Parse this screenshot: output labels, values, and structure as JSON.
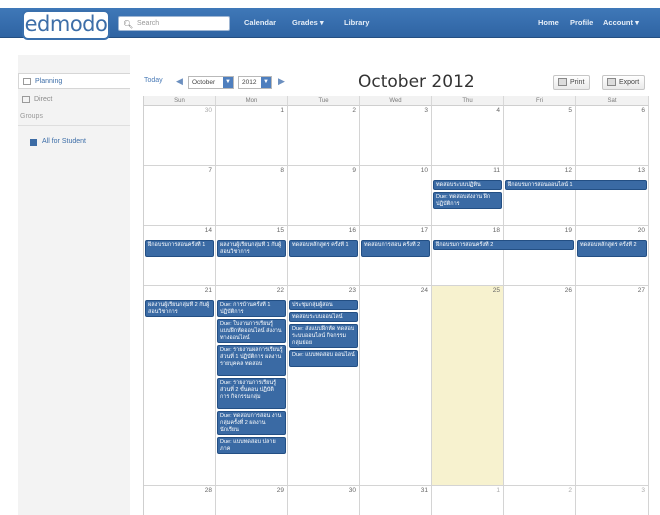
{
  "header": {
    "logo": "edmodo",
    "search_placeholder": "Search",
    "nav_left": [
      "Calendar",
      "Grades ▾",
      "Library"
    ],
    "nav_right": [
      "Home",
      "Profile",
      "Account ▾"
    ]
  },
  "sidebar": {
    "items": [
      {
        "label": "Planning",
        "active": true
      },
      {
        "label": "Direct",
        "active": false
      }
    ],
    "groups_label": "Groups",
    "groups": [
      {
        "label": "All for Student",
        "color": "#3c6ba4"
      }
    ]
  },
  "toolbar": {
    "today": "Today",
    "month_select": "October",
    "year_select": "2012",
    "title": "October 2012",
    "print": "Print",
    "export": "Export"
  },
  "calendar": {
    "weekdays": [
      "Sun",
      "Mon",
      "Tue",
      "Wed",
      "Thu",
      "Fri",
      "Sat"
    ],
    "today_cell": {
      "week": 3,
      "day": 4
    },
    "weeks": [
      {
        "days": [
          {
            "num": "30",
            "other": true
          },
          {
            "num": "1",
            "other": false
          },
          {
            "num": "2",
            "other": false
          },
          {
            "num": "3",
            "other": false
          },
          {
            "num": "4",
            "other": false
          },
          {
            "num": "5",
            "other": false
          },
          {
            "num": "6",
            "other": false
          }
        ]
      },
      {
        "days": [
          {
            "num": "7",
            "other": false
          },
          {
            "num": "8",
            "other": false
          },
          {
            "num": "9",
            "other": false
          },
          {
            "num": "10",
            "other": false
          },
          {
            "num": "11",
            "other": false
          },
          {
            "num": "12",
            "other": false
          },
          {
            "num": "13",
            "other": false
          }
        ]
      },
      {
        "days": [
          {
            "num": "14",
            "other": false
          },
          {
            "num": "15",
            "other": false
          },
          {
            "num": "16",
            "other": false
          },
          {
            "num": "17",
            "other": false
          },
          {
            "num": "18",
            "other": false
          },
          {
            "num": "19",
            "other": false
          },
          {
            "num": "20",
            "other": false
          }
        ]
      },
      {
        "days": [
          {
            "num": "21",
            "other": false
          },
          {
            "num": "22",
            "other": false
          },
          {
            "num": "23",
            "other": false
          },
          {
            "num": "24",
            "other": false
          },
          {
            "num": "25",
            "other": false
          },
          {
            "num": "26",
            "other": false
          },
          {
            "num": "27",
            "other": false
          }
        ]
      },
      {
        "days": [
          {
            "num": "28",
            "other": false
          },
          {
            "num": "29",
            "other": false
          },
          {
            "num": "30",
            "other": false
          },
          {
            "num": "31",
            "other": false
          },
          {
            "num": "1",
            "other": true
          },
          {
            "num": "2",
            "other": true
          },
          {
            "num": "3",
            "other": true
          }
        ]
      }
    ],
    "events": [
      {
        "week": 1,
        "day": 4,
        "span": 1,
        "slot": 0,
        "lines": 1,
        "text": "ทดสอบระบบปฏิทิน"
      },
      {
        "week": 1,
        "day": 4,
        "span": 1,
        "slot": 1,
        "lines": 2,
        "text": "Due: ทดสอบส่งงาน ฝึกปฏิบัติการ"
      },
      {
        "week": 1,
        "day": 5,
        "span": 2,
        "slot": 0,
        "lines": 1,
        "text": "ฝึกอบรมการสอนออนไลน์ 1"
      },
      {
        "week": 2,
        "day": 0,
        "span": 1,
        "slot": 0,
        "lines": 2,
        "text": "ฝึกอบรมการสอนครั้งที่ 1"
      },
      {
        "week": 2,
        "day": 1,
        "span": 1,
        "slot": 0,
        "lines": 2,
        "text": "ผลงานผู้เรียนกลุ่มที่ 1 กับผู้สอนวิชาการ"
      },
      {
        "week": 2,
        "day": 2,
        "span": 1,
        "slot": 0,
        "lines": 2,
        "text": "ทดสอบหลักสูตร ครั้งที่ 1"
      },
      {
        "week": 2,
        "day": 3,
        "span": 1,
        "slot": 0,
        "lines": 2,
        "text": "ทดสอบการสอน ครั้งที่ 2"
      },
      {
        "week": 2,
        "day": 4,
        "span": 2,
        "slot": 0,
        "lines": 1,
        "text": "ฝึกอบรมการสอนครั้งที่ 2"
      },
      {
        "week": 2,
        "day": 6,
        "span": 1,
        "slot": 0,
        "lines": 2,
        "text": "ทดสอบหลักสูตร ครั้งที่ 2"
      },
      {
        "week": 3,
        "day": 0,
        "span": 1,
        "slot": 0,
        "lines": 2,
        "text": "ผลงานผู้เรียนกลุ่มที่ 2 กับผู้สอนวิชาการ"
      },
      {
        "week": 3,
        "day": 1,
        "span": 1,
        "slot": 0,
        "lines": 2,
        "text": "Due: การบ้านครั้งที่ 1 ปฏิบัติการ"
      },
      {
        "week": 3,
        "day": 1,
        "span": 1,
        "slot": 1,
        "lines": 3,
        "text": "Due: ใบงานการเรียนรู้ แบบฝึกหัดออนไลน์ ส่งงานทางออนไลน์"
      },
      {
        "week": 3,
        "day": 1,
        "span": 1,
        "slot": 2,
        "lines": 4,
        "text": "Due: รายงานผลการเรียนรู้ ส่วนที่ 1 ปฏิบัติการ ผลงานรายบุคคล ทดสอบ"
      },
      {
        "week": 3,
        "day": 1,
        "span": 1,
        "slot": 3,
        "lines": 4,
        "text": "Due: รายงานการเรียนรู้ ส่วนที่ 2 ขั้นตอน ปฏิบัติการ กิจกรรมกลุ่ม"
      },
      {
        "week": 3,
        "day": 1,
        "span": 1,
        "slot": 4,
        "lines": 3,
        "text": "Due: ทดสอบการสอน งานกลุ่มครั้งที่ 2 ผลงานนักเรียน"
      },
      {
        "week": 3,
        "day": 1,
        "span": 1,
        "slot": 5,
        "lines": 2,
        "text": "Due: แบบทดสอบ ปลายภาค"
      },
      {
        "week": 3,
        "day": 2,
        "span": 1,
        "slot": 0,
        "lines": 1,
        "text": "ประชุมกลุ่มผู้สอน"
      },
      {
        "week": 3,
        "day": 2,
        "span": 1,
        "slot": 1,
        "lines": 1,
        "text": "ทดสอบระบบออนไลน์"
      },
      {
        "week": 3,
        "day": 2,
        "span": 1,
        "slot": 2,
        "lines": 3,
        "text": "Due: ส่งแบบฝึกหัด ทดสอบระบบออนไลน์ กิจกรรมกลุ่มย่อย"
      },
      {
        "week": 3,
        "day": 2,
        "span": 1,
        "slot": 3,
        "lines": 2,
        "text": "Due: แบบทดสอบ ออนไลน์"
      }
    ]
  }
}
